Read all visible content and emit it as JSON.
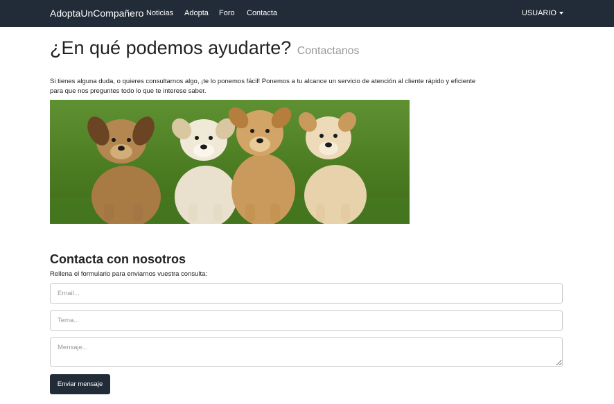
{
  "navbar": {
    "brand": "AdoptaUnCompañero",
    "links": [
      "Noticias",
      "Adopta",
      "Foro",
      "Contacta"
    ],
    "user_menu": "USUARIO"
  },
  "header": {
    "title": "¿En qué podemos ayudarte?",
    "subtitle": "Contactanos"
  },
  "intro": "Si tienes alguna duda, o quieres consultarnos algo, ¡te lo ponemos fácil! Ponemos a tu alcance un servicio de atención al cliente rápido y eficiente para que nos preguntes todo lo que te interese saber.",
  "contact": {
    "title": "Contacta con nosotros",
    "description": "Rellena el formulario para enviarnos vuestra consulta:",
    "email_placeholder": "Email...",
    "tema_placeholder": "Tema...",
    "mensaje_placeholder": "Mensaje...",
    "submit_label": "Enviar mensaje"
  }
}
